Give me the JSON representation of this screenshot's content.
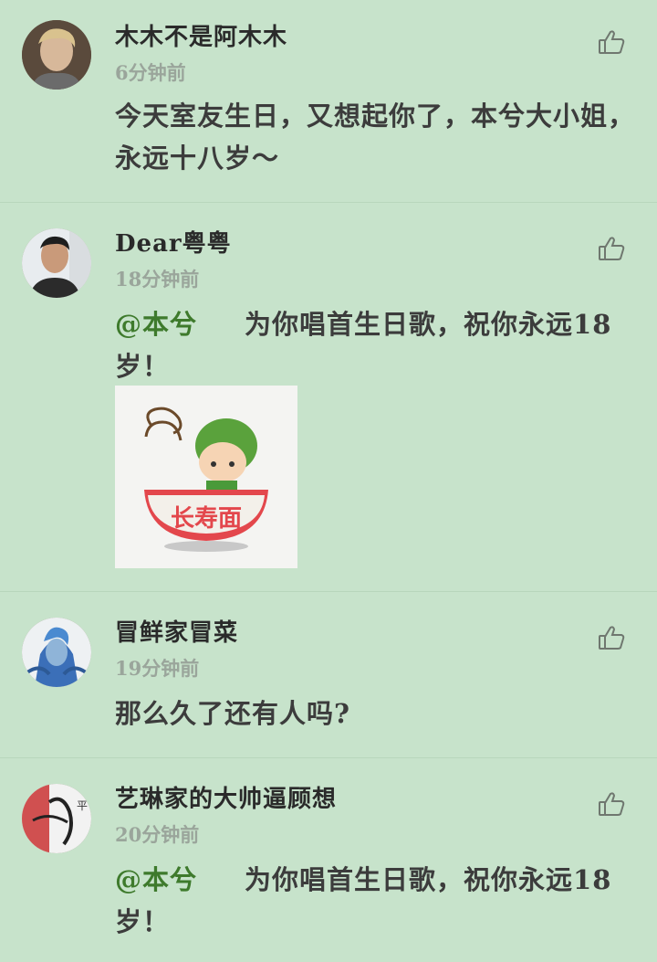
{
  "comments": [
    {
      "username": "木木不是阿木木",
      "time": "6分钟前",
      "text": "今天室友生日，又想起你了，本兮大小姐，永远十八岁～"
    },
    {
      "username": "Dear粤粤",
      "time": "18分钟前",
      "mention": "@本兮",
      "text": "为你唱首生日歌，祝你永远18岁！",
      "sticker_text": "长寿面"
    },
    {
      "username": "冒鲜家冒菜",
      "time": "19分钟前",
      "text": "那么久了还有人吗?"
    },
    {
      "username": "艺琳家的大帅逼顾想",
      "time": "20分钟前",
      "mention": "@本兮",
      "text": "为你唱首生日歌，祝你永远18岁！"
    }
  ],
  "icons": {
    "like": "thumbs-up-icon",
    "avatar": "avatar"
  },
  "colors": {
    "background": "#c7e3cb",
    "mention": "#3e7a2c",
    "time": "#9aa59b"
  }
}
